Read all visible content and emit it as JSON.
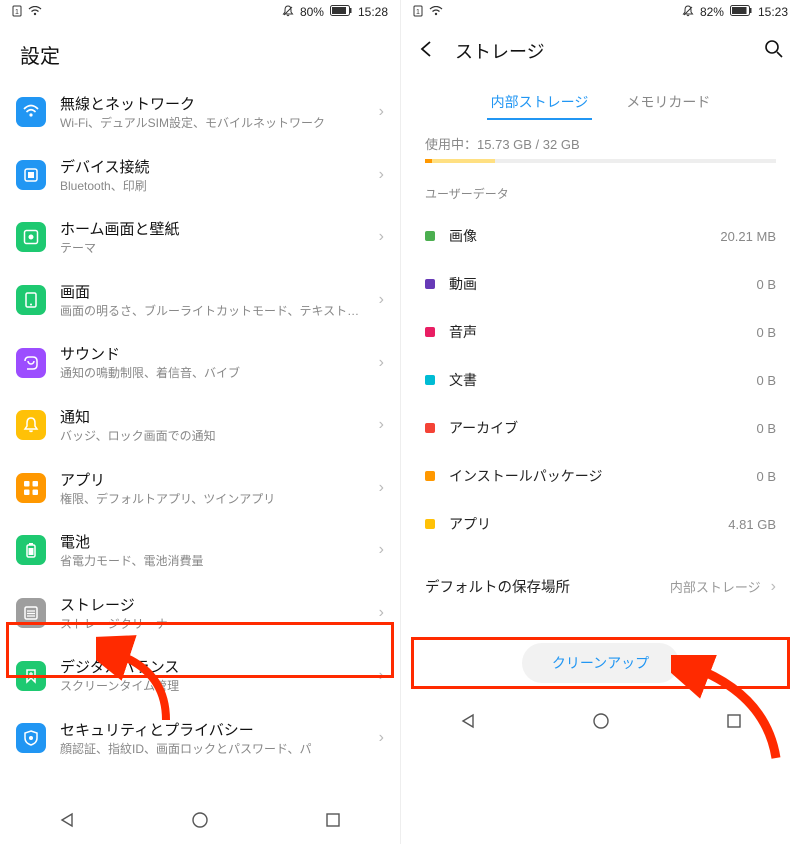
{
  "left": {
    "status": {
      "battery": "80%",
      "time": "15:28"
    },
    "title": "設定",
    "items": [
      {
        "title": "無線とネットワーク",
        "sub": "Wi-Fi、デュアルSIM設定、モバイルネットワーク",
        "icon_bg": "#2196F3"
      },
      {
        "title": "デバイス接続",
        "sub": "Bluetooth、印刷",
        "icon_bg": "#2196F3"
      },
      {
        "title": "ホーム画面と壁紙",
        "sub": "テーマ",
        "icon_bg": "#1EC971"
      },
      {
        "title": "画面",
        "sub": "画面の明るさ、ブルーライトカットモード、テキストサイズと表示サイズ",
        "icon_bg": "#1EC971"
      },
      {
        "title": "サウンド",
        "sub": "通知の鳴動制限、着信音、バイブ",
        "icon_bg": "#9C4DFF"
      },
      {
        "title": "通知",
        "sub": "バッジ、ロック画面での通知",
        "icon_bg": "#FFC107"
      },
      {
        "title": "アプリ",
        "sub": "権限、デフォルトアプリ、ツインアプリ",
        "icon_bg": "#FF9800"
      },
      {
        "title": "電池",
        "sub": "省電力モード、電池消費量",
        "icon_bg": "#1EC971"
      },
      {
        "title": "ストレージ",
        "sub": "ストレージクリーナー",
        "icon_bg": "#9E9E9E"
      },
      {
        "title": "デジタルバランス",
        "sub": "スクリーンタイム管理",
        "icon_bg": "#1EC971"
      },
      {
        "title": "セキュリティとプライバシー",
        "sub": "顔認証、指紋ID、画面ロックとパスワード、パ",
        "icon_bg": "#2196F3"
      }
    ]
  },
  "right": {
    "status": {
      "battery": "82%",
      "time": "15:23"
    },
    "title": "ストレージ",
    "tabs": {
      "internal": "内部ストレージ",
      "card": "メモリカード"
    },
    "usage_label": "使用中：",
    "usage_value": "15.73 GB / 32 GB",
    "progress": [
      {
        "color": "#FF9800",
        "start": 0,
        "end": 2
      },
      {
        "color": "#FFE082",
        "start": 2,
        "end": 20
      }
    ],
    "section": "ユーザーデータ",
    "data": [
      {
        "label": "画像",
        "val": "20.21 MB",
        "color": "#4CAF50"
      },
      {
        "label": "動画",
        "val": "0 B",
        "color": "#673AB7"
      },
      {
        "label": "音声",
        "val": "0 B",
        "color": "#E91E63"
      },
      {
        "label": "文書",
        "val": "0 B",
        "color": "#00BCD4"
      },
      {
        "label": "アーカイブ",
        "val": "0 B",
        "color": "#F44336"
      },
      {
        "label": "インストールパッケージ",
        "val": "0 B",
        "color": "#FF9800"
      },
      {
        "label": "アプリ",
        "val": "4.81 GB",
        "color": "#FFC107"
      }
    ],
    "default_location_label": "デフォルトの保存場所",
    "default_location_value": "内部ストレージ",
    "cleanup": "クリーンアップ"
  }
}
